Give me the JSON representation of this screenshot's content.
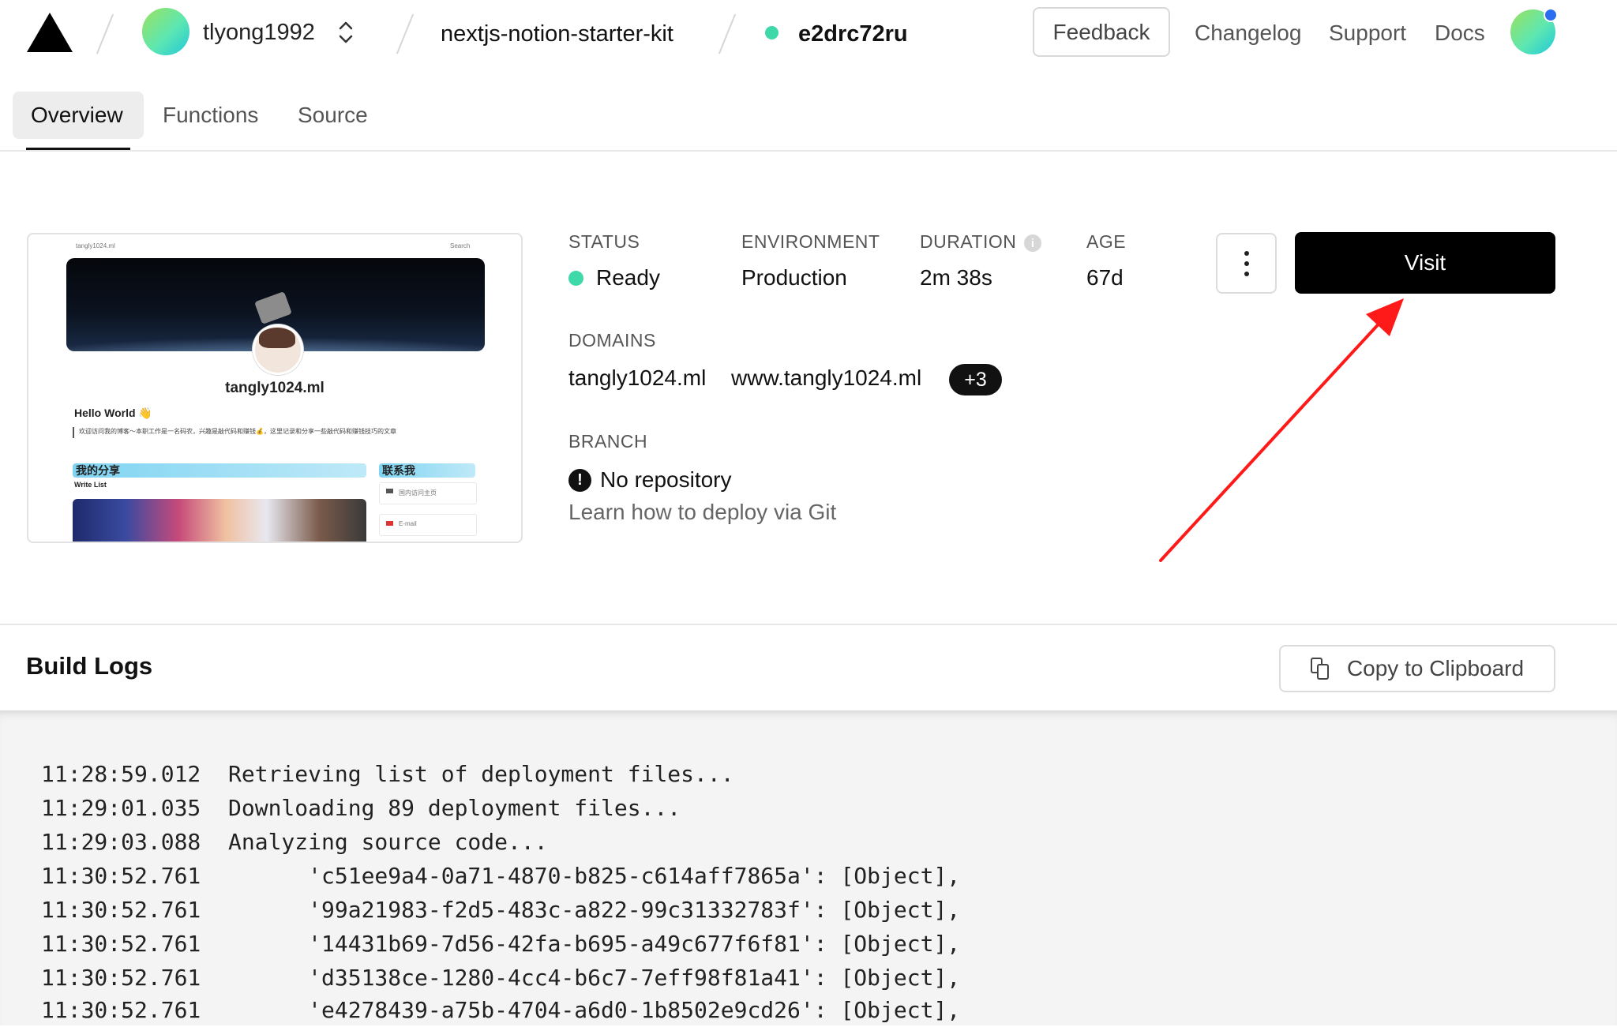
{
  "header": {
    "team": "tlyong1992",
    "project": "nextjs-notion-starter-kit",
    "deployment_id": "e2drc72ru",
    "feedback_label": "Feedback",
    "nav": [
      "Changelog",
      "Support",
      "Docs"
    ],
    "icons": [
      "vercel-logo-icon",
      "chevron-up-down-icon",
      "notification-dot"
    ]
  },
  "tabs": [
    "Overview",
    "Functions",
    "Source"
  ],
  "active_tab": "Overview",
  "preview": {
    "site_small": "tangly1024.ml",
    "search_small": "Search",
    "site_name": "tangly1024.ml",
    "hello": "Hello World 👋",
    "intro": "欢迎访问我的博客～本职工作是一名码农，兴趣是敲代码和赚钱💰，这里记录和分享一些敲代码和赚钱技巧的文章",
    "share_heading": "我的分享",
    "write_list": "Write List",
    "contact_heading": "联系我",
    "contact_items": [
      "国内访问主页",
      "E-mail"
    ]
  },
  "info": {
    "status_label": "STATUS",
    "status_value": "Ready",
    "environment_label": "ENVIRONMENT",
    "environment_value": "Production",
    "duration_label": "DURATION",
    "duration_value": "2m 38s",
    "age_label": "AGE",
    "age_value": "67d",
    "domains_label": "DOMAINS",
    "domains": [
      "tangly1024.ml",
      "www.tangly1024.ml"
    ],
    "domains_more": "+3",
    "branch_label": "BRANCH",
    "branch_value": "No repository",
    "branch_hint": "Learn how to deploy via Git"
  },
  "actions": {
    "visit_label": "Visit"
  },
  "colors": {
    "ready": "#3fd8a8",
    "annotation_arrow": "#ff1a1a",
    "primary_button": "#000000"
  },
  "build_logs": {
    "title": "Build Logs",
    "copy_label": "Copy to Clipboard",
    "lines": [
      {
        "time": "11:28:59.012",
        "text": "Retrieving list of deployment files..."
      },
      {
        "time": "11:29:01.035",
        "text": "Downloading 89 deployment files..."
      },
      {
        "time": "11:29:03.088",
        "text": "Analyzing source code..."
      },
      {
        "time": "11:30:52.761",
        "text": "      'c51ee9a4-0a71-4870-b825-c614aff7865a': [Object],"
      },
      {
        "time": "11:30:52.761",
        "text": "      '99a21983-f2d5-483c-a822-99c31332783f': [Object],"
      },
      {
        "time": "11:30:52.761",
        "text": "      '14431b69-7d56-42fa-b695-a49c677f6f81': [Object],"
      },
      {
        "time": "11:30:52.761",
        "text": "      'd35138ce-1280-4cc4-b6c7-7eff98f81a41': [Object],"
      },
      {
        "time": "11:30:52.761",
        "text": "      'e4278439-a75b-4704-a6d0-1b8502e9cd26': [Object],"
      }
    ]
  }
}
